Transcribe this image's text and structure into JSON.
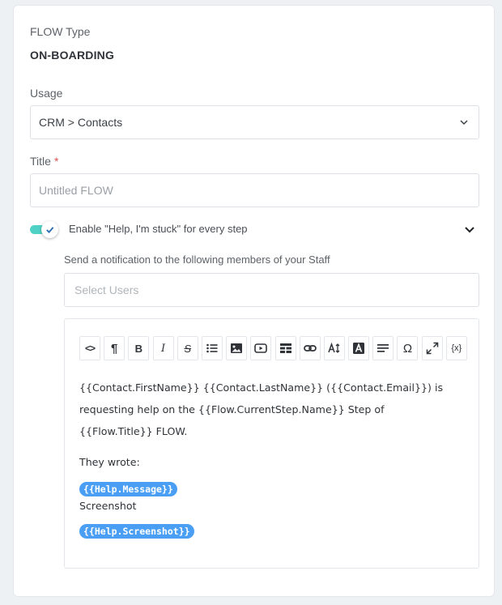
{
  "flow_type": {
    "label": "FLOW Type",
    "value": "ON-BOARDING"
  },
  "usage": {
    "label": "Usage",
    "selected": "CRM > Contacts"
  },
  "title": {
    "label": "Title",
    "required_mark": "*",
    "value": "Untitled FLOW"
  },
  "help": {
    "enabled": true,
    "label": "Enable \"Help, I'm stuck\" for every step",
    "notify_label": "Send a notification to the following members of your Staff",
    "users_placeholder": "Select Users"
  },
  "toolbar": {
    "buttons": [
      "code-view",
      "paragraph",
      "bold",
      "italic",
      "strikethrough",
      "unordered-list",
      "image",
      "video",
      "table",
      "link",
      "font-size",
      "text-color",
      "align",
      "special-characters",
      "fullscreen",
      "variables"
    ],
    "bold_glyph": "B",
    "italic_glyph": "I",
    "strike_glyph": "S",
    "para_glyph": "¶",
    "code_glyph": "<>",
    "omega_glyph": "Ω",
    "var_glyph": "{x}"
  },
  "message": {
    "line1": "{{Contact.FirstName}} {{Contact.LastName}} ({{Contact.Email}}) is requesting help on the {{Flow.CurrentStep.Name}} Step of {{Flow.Title}} FLOW.",
    "wrote": "They wrote:",
    "tag_message": "{{Help.Message}}",
    "screenshot_label": "Screenshot",
    "tag_screenshot": "{{Help.Screenshot}}"
  },
  "colors": {
    "accent": "#4a9ff5",
    "toggle": "#4fd1c5",
    "required": "#d9534f"
  }
}
